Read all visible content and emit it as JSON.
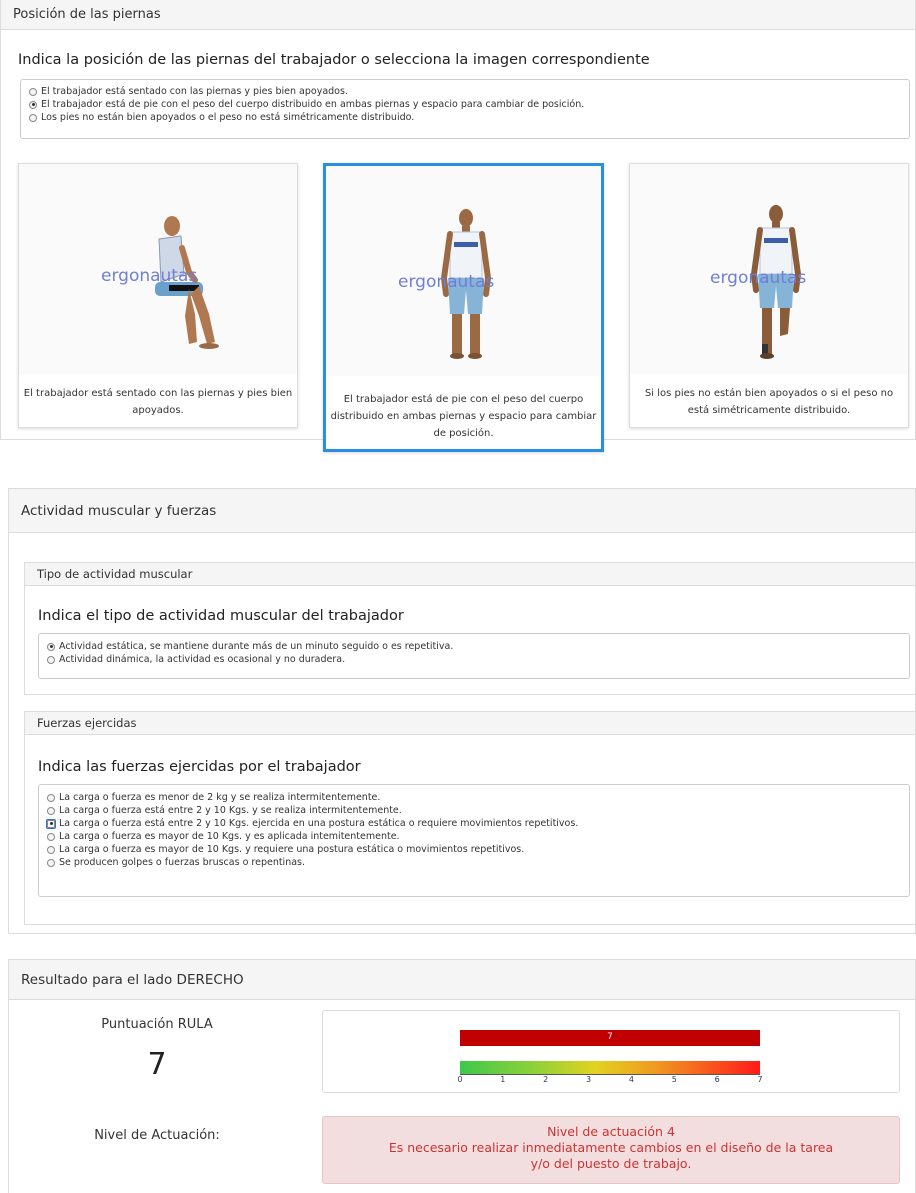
{
  "legs": {
    "title": "Posición de las piernas",
    "question": "Indica la posición de las piernas del trabajador o selecciona la imagen correspondiente",
    "options": [
      {
        "label": "El trabajador está sentado con las piernas y pies bien apoyados.",
        "checked": false
      },
      {
        "label": "El trabajador está de pie con el peso del cuerpo distribuido en ambas piernas y espacio para cambiar de posición.",
        "checked": true
      },
      {
        "label": "Los pies no están bien apoyados o el peso no está simétricamente distribuido.",
        "checked": false
      }
    ],
    "cards": [
      {
        "logo": "ergonautas",
        "caption": "El trabajador está sentado con las piernas y pies bien apoyados.",
        "selected": false
      },
      {
        "logo": "ergonautas",
        "caption": "El trabajador está de pie con el peso del cuerpo distribuido en ambas piernas y espacio para cambiar de posición.",
        "selected": true
      },
      {
        "logo": "ergonautas",
        "caption": "Si los pies no están bien apoyados o si el peso no está simétricamente distribuido.",
        "selected": false
      }
    ]
  },
  "muscle": {
    "title": "Actividad muscular y fuerzas",
    "activity": {
      "title": "Tipo de actividad muscular",
      "question": "Indica el tipo de actividad muscular del trabajador",
      "options": [
        {
          "label": "Actividad estática, se mantiene durante más de un minuto seguido o es repetitiva.",
          "checked": true
        },
        {
          "label": "Actividad dinámica, la actividad es ocasional y no duradera.",
          "checked": false
        }
      ]
    },
    "forces": {
      "title": "Fuerzas ejercidas",
      "question": "Indica las fuerzas ejercidas por el trabajador",
      "options": [
        {
          "label": "La carga o fuerza es menor de 2 kg y se realiza intermitentemente.",
          "checked": false
        },
        {
          "label": "La carga o fuerza está entre 2 y 10 Kgs. y se realiza intermitentemente.",
          "checked": false
        },
        {
          "label": "La carga o fuerza está entre 2 y 10 Kgs. ejercida en una postura estática o requiere movimientos repetitivos.",
          "checked": true
        },
        {
          "label": "La carga o fuerza es mayor de 10 Kgs. y es aplicada intemitentemente.",
          "checked": false
        },
        {
          "label": "La carga o fuerza es mayor de 10 Kgs. y requiere una postura estática o movimientos repetitivos.",
          "checked": false
        },
        {
          "label": "Se producen golpes o fuerzas bruscas o repentinas.",
          "checked": false
        }
      ]
    }
  },
  "result": {
    "title": "Resultado para el lado DERECHO",
    "score_label": "Puntuación RULA",
    "score": "7",
    "bar_value": "7",
    "bar_fraction": 1.0,
    "bar_color": "#c00000",
    "scale_ticks": [
      "0",
      "1",
      "2",
      "3",
      "4",
      "5",
      "6",
      "7"
    ],
    "level_label": "Nivel de Actuación:",
    "level_lines": [
      "Nivel de actuación 4",
      "Es necesario realizar inmediatamente cambios en el diseño de la tarea",
      "y/o del puesto de trabajo."
    ]
  }
}
